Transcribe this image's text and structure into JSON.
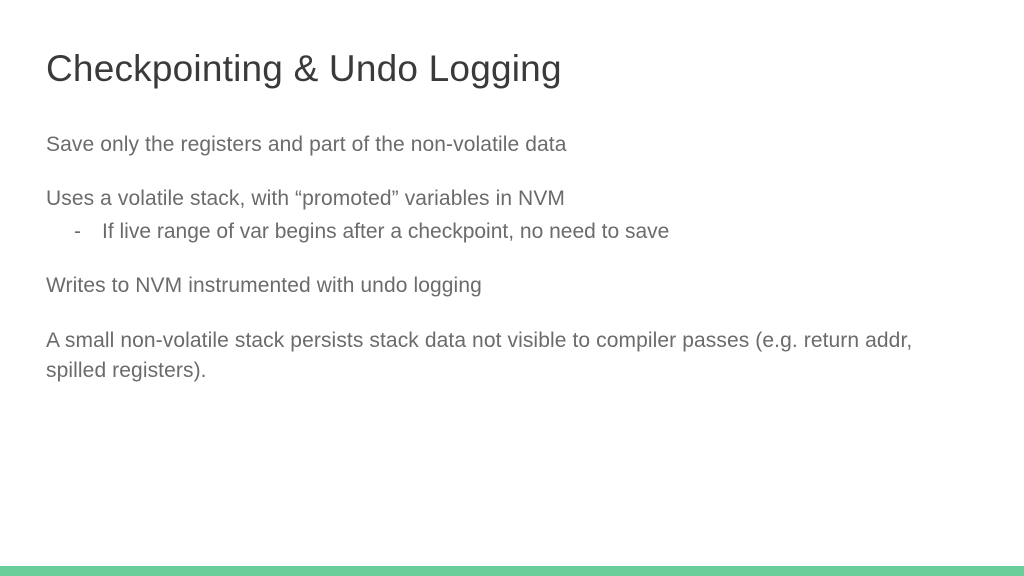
{
  "slide": {
    "title": "Checkpointing & Undo Logging",
    "p1": "Save only the registers and part of the non-volatile data",
    "p2": "Uses a volatile stack, with “promoted” variables in NVM",
    "p2_sub1": "If live range of var begins after a checkpoint, no need to save",
    "p3": "Writes to NVM instrumented with undo logging",
    "p4": "A small non-volatile stack persists stack data not visible to compiler passes (e.g. return addr, spilled registers)."
  },
  "accent_color": "#6ace9a"
}
